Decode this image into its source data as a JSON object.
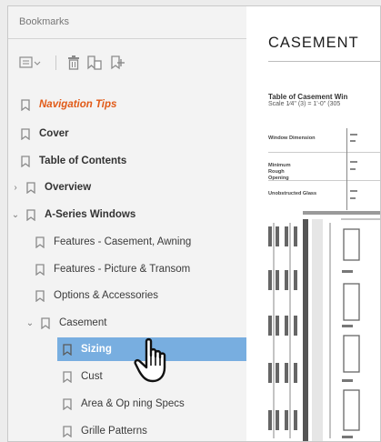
{
  "sidebar": {
    "header": "Bookmarks",
    "toolbar": [
      {
        "name": "bookmark-options-icon"
      },
      {
        "name": "delete-bookmark-icon"
      },
      {
        "name": "new-bookmark-from-structure-icon"
      },
      {
        "name": "new-bookmark-icon"
      }
    ],
    "items": [
      {
        "label": "Navigation Tips",
        "style": "orange"
      },
      {
        "label": "Cover",
        "style": "bold"
      },
      {
        "label": "Table of Contents",
        "style": "bold"
      },
      {
        "label": "Overview",
        "style": "bold",
        "toggle": "collapsed"
      },
      {
        "label": "A-Series Windows",
        "style": "bold",
        "toggle": "expanded"
      },
      {
        "label": "Features - Casement, Awning",
        "style": "normal"
      },
      {
        "label": "Features - Picture & Transom",
        "style": "normal"
      },
      {
        "label": "Options & Accessories",
        "style": "normal"
      },
      {
        "label": "Casement",
        "style": "normal",
        "toggle": "expanded"
      },
      {
        "label": "Sizing",
        "style": "selected"
      },
      {
        "label": "Cust",
        "style": "normal"
      },
      {
        "label": "Area & Op ning Specs",
        "style": "normal"
      },
      {
        "label": "Grille Patterns",
        "style": "normal"
      }
    ]
  },
  "document": {
    "title": "CASEMENT",
    "subtitle": "Table of Casement Win",
    "scale": "Scale 1⁄4\" (3) = 1'-0\" (305",
    "row_labels": [
      "Window Dimension",
      "Minimum Rough Opening",
      "Unobstructed Glass"
    ]
  },
  "colors": {
    "selection": "#78aee0",
    "accent_orange": "#e15a17",
    "bookmark_icon": "#8a8a8a"
  }
}
